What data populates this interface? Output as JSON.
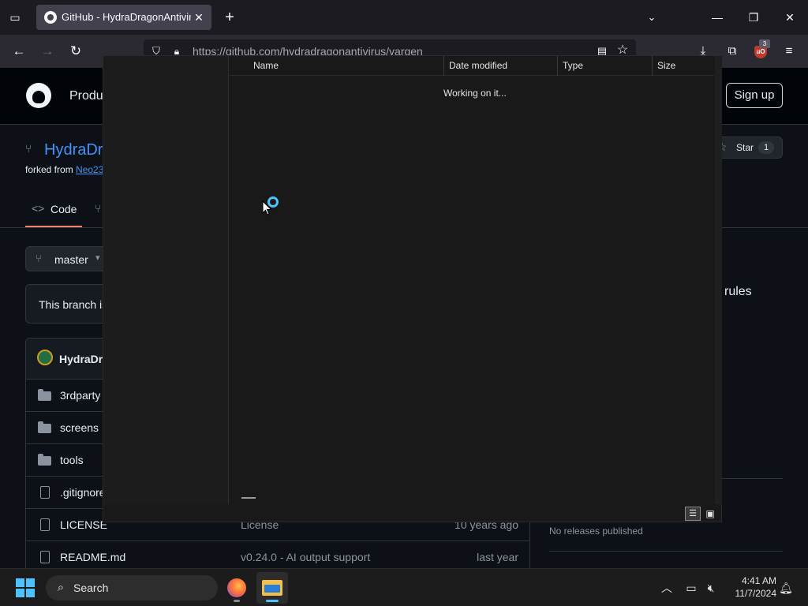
{
  "browser": {
    "tab_title": "GitHub - HydraDragonAntivirus",
    "url": "https://github.com/hydradragonantivirus/yargen",
    "extension_badge": "3",
    "icons": [
      "list-all-tabs-icon",
      "github-favicon",
      "close-icon",
      "plus-icon",
      "chevron-down-icon",
      "minimize-icon",
      "restore-icon",
      "close-window-icon",
      "back-arrow-icon",
      "forward-arrow-icon",
      "reload-icon",
      "shield-icon",
      "lock-icon",
      "reader-view-icon",
      "star-icon",
      "download-icon",
      "extensions-icon",
      "ublock-icon",
      "menu-icon"
    ]
  },
  "github": {
    "header_product": "Produ",
    "signup_label": "Sign up",
    "repo_name": "HydraDr",
    "forked_from_prefix": "forked from ",
    "forked_from_link": "Neo23",
    "star_label": "Star",
    "star_count": "1",
    "code_tab_label": "Code",
    "branch_name": "master",
    "branch_notice": "This branch is",
    "rules_text": "rules",
    "commit_author": "HydraDra",
    "files": [
      {
        "name": "3rdparty",
        "type": "folder",
        "message": "",
        "time": ""
      },
      {
        "name": "screens",
        "type": "folder",
        "message": "",
        "time": ""
      },
      {
        "name": "tools",
        "type": "folder",
        "message": "",
        "time": ""
      },
      {
        "name": ".gitignore",
        "type": "file",
        "message": "",
        "time": ""
      },
      {
        "name": "LICENSE",
        "type": "file",
        "message": "License",
        "time": "10 years ago"
      },
      {
        "name": "README.md",
        "type": "file",
        "message": "v0.24.0 - AI output support",
        "time": "last year"
      }
    ],
    "releases_empty": "No releases published"
  },
  "dialog": {
    "columns": [
      "Name",
      "Date modified",
      "Type",
      "Size"
    ],
    "status": "Working on it..."
  },
  "taskbar": {
    "search_label": "Search",
    "time": "4:41 AM",
    "date": "11/7/2024",
    "accent": "#4cc2ff"
  }
}
